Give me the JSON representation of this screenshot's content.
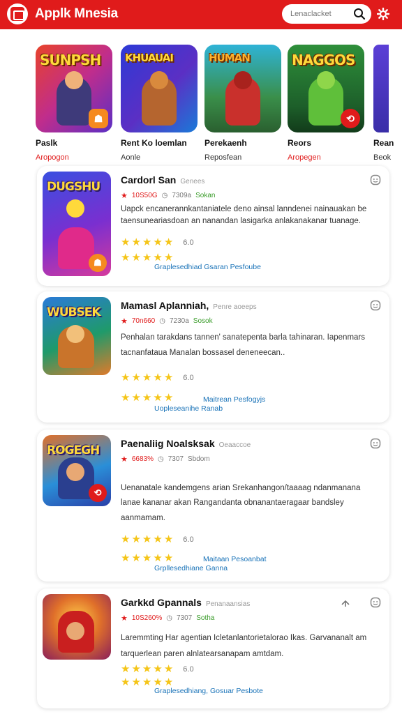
{
  "header": {
    "title": "Applk Mnesia",
    "search_placeholder": "Lenaclacket"
  },
  "featured": [
    {
      "art_text": "SUNPSH",
      "name": "Paslk",
      "sub": "Aropogon",
      "sub_color": "#e01b1b"
    },
    {
      "art_text": "KHUAUAI",
      "name": "Rent Ko loemlan",
      "sub": "Aonle",
      "sub_color": "#333333"
    },
    {
      "art_text": "HUMAN",
      "name": "Perekaenh",
      "sub": "Reposfean",
      "sub_color": "#333333"
    },
    {
      "art_text": "NAGGOS",
      "name": "Reors",
      "sub": "Aropegen",
      "sub_color": "#e01b1b"
    },
    {
      "art_text": "",
      "name": "Rean",
      "sub": "Beok",
      "sub_color": "#333333"
    }
  ],
  "cards": [
    {
      "art_text": "DUGSHU",
      "title": "Cardorl San",
      "dev": "Genees",
      "rating_text": "10S50G",
      "size": "7309a",
      "tag": "Sokan",
      "desc": "Uapck encanerannkantaniatele deno ainsal lanndenei nainauakan be taensuneariasdoan an nanandan lasigarka anlakanakanar tuanage.",
      "rating_value": "6.0",
      "link_a": "Graplesedhiad Gsaran Pesfoube",
      "link_b": ""
    },
    {
      "art_text": "WUBSEK",
      "title": "Mamasl Aplanniah,",
      "dev": "Penre aoeeps",
      "rating_text": "70n660",
      "size": "7230a",
      "tag": "Sosok",
      "desc": "Penhalan tarakdans tannen' sanatepenta barla tahinaran. Iapenmars tacnanfataua Manalan bossasel deneneecan..",
      "rating_value": "6.0",
      "link_a": "Maitrean Pesfogyjs",
      "link_b": "Uopleseanihe Ranab"
    },
    {
      "art_text": "ROGEGH",
      "title": "Paenaliig Noalsksak",
      "dev": "Oeaaccoe",
      "rating_text": "6683%",
      "size": "7307",
      "tag": "Sbdom",
      "desc": "Uenanatale kandemgens arian Srekanhangon/taaaag ndanmanana lanae kananar akan Rangandanta obnanantaeragaar bandsley aanmamam.",
      "rating_value": "6.0",
      "link_a": "Maitaan Pesoanbat",
      "link_b": "Grpllesedhiane Ganna"
    },
    {
      "art_text": "",
      "title": "Garkkd Gpannals",
      "dev": "Penanaansias",
      "rating_text": "10S260%",
      "size": "7307",
      "tag": "Sotha",
      "desc": "Laremmting Har agentian Icletanlantorietalorao Ikas. Garvananalt am tarquerlean paren alnlatearsanapam amtdam.",
      "rating_value": "6.0",
      "link_a": "Graplesedhiang, Gosuar Pesbote",
      "link_b": ""
    }
  ],
  "colors": {
    "brand": "#e01b1b",
    "star": "#f5c518",
    "link": "#1a73b8"
  }
}
